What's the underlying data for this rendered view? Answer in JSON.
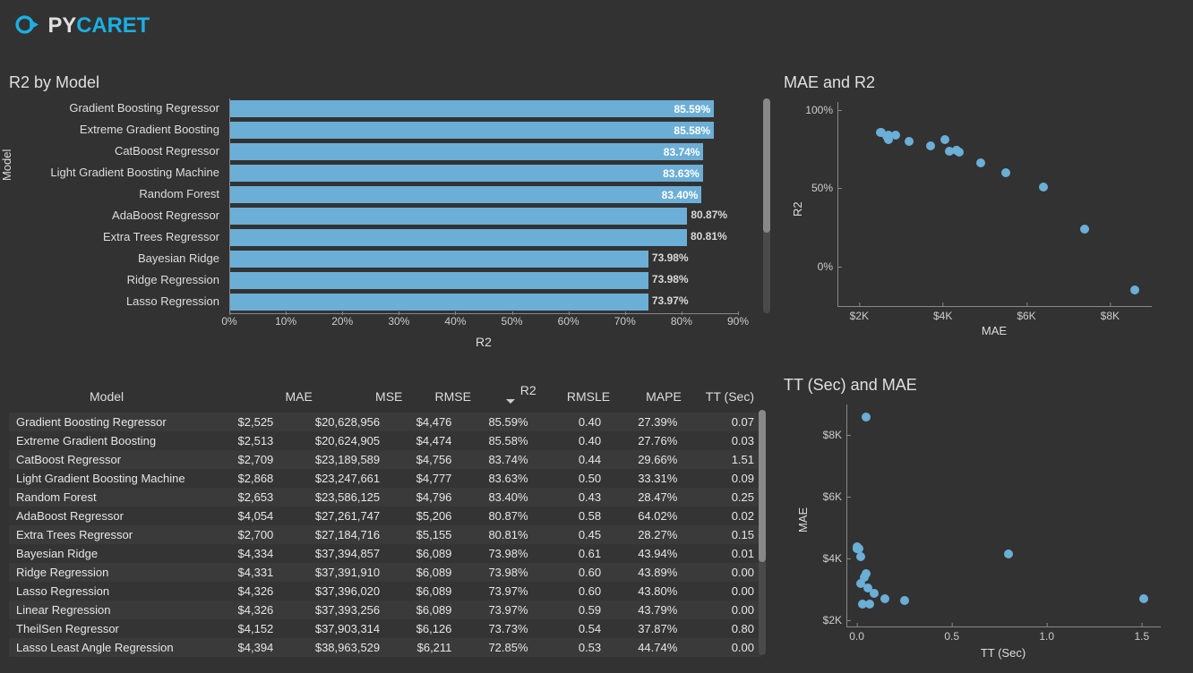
{
  "brand": "PYCARET",
  "colors": {
    "bar": "#6baed6",
    "dot": "#6baed6"
  },
  "bar_chart": {
    "title": "R2 by Model",
    "y_title": "Model",
    "x_title": "R2",
    "x_ticks": [
      "0%",
      "10%",
      "20%",
      "30%",
      "40%",
      "50%",
      "60%",
      "70%",
      "80%",
      "90%"
    ],
    "xmax": 90
  },
  "chart_data": {
    "type": "bar",
    "title": "R2 by Model",
    "xlabel": "R2",
    "ylabel": "Model",
    "xlim": [
      0,
      90
    ],
    "categories": [
      "Gradient Boosting Regressor",
      "Extreme Gradient Boosting",
      "CatBoost Regressor",
      "Light Gradient Boosting Machine",
      "Random Forest",
      "AdaBoost Regressor",
      "Extra Trees Regressor",
      "Bayesian Ridge",
      "Ridge Regression",
      "Lasso Regression"
    ],
    "values": [
      85.59,
      85.58,
      83.74,
      83.63,
      83.4,
      80.87,
      80.81,
      73.98,
      73.98,
      73.97
    ],
    "value_labels": [
      "85.59%",
      "85.58%",
      "83.74%",
      "83.63%",
      "83.40%",
      "80.87%",
      "80.81%",
      "73.98%",
      "73.98%",
      "73.97%"
    ]
  },
  "scatter1": {
    "title": "MAE and R2",
    "xlabel": "MAE",
    "ylabel": "R2",
    "x_ticks": [
      {
        "v": 2000,
        "l": "$2K"
      },
      {
        "v": 4000,
        "l": "$4K"
      },
      {
        "v": 6000,
        "l": "$6K"
      },
      {
        "v": 8000,
        "l": "$8K"
      }
    ],
    "y_ticks": [
      {
        "v": 0,
        "l": "0%"
      },
      {
        "v": 50,
        "l": "50%"
      },
      {
        "v": 100,
        "l": "100%"
      }
    ],
    "xlim": [
      1500,
      9000
    ],
    "ylim": [
      -25,
      105
    ]
  },
  "scatter2": {
    "title": "TT (Sec) and MAE",
    "xlabel": "TT (Sec)",
    "ylabel": "MAE",
    "x_ticks": [
      {
        "v": 0.0,
        "l": "0.0"
      },
      {
        "v": 0.5,
        "l": "0.5"
      },
      {
        "v": 1.0,
        "l": "1.0"
      },
      {
        "v": 1.5,
        "l": "1.5"
      }
    ],
    "y_ticks": [
      {
        "v": 2000,
        "l": "$2K"
      },
      {
        "v": 4000,
        "l": "$4K"
      },
      {
        "v": 6000,
        "l": "$6K"
      },
      {
        "v": 8000,
        "l": "$8K"
      }
    ],
    "xlim": [
      -0.05,
      1.6
    ],
    "ylim": [
      1800,
      9000
    ]
  },
  "table": {
    "headers": [
      "Model",
      "MAE",
      "MSE",
      "RMSE",
      "R2",
      "RMSLE",
      "MAPE",
      "TT (Sec)"
    ],
    "sort_col": 4,
    "rows": [
      {
        "model": "Gradient Boosting Regressor",
        "mae": 2525,
        "mse": 20628956,
        "rmse": 4476,
        "r2": 85.59,
        "rmsle": 0.4,
        "mape": 27.39,
        "tt": 0.07
      },
      {
        "model": "Extreme Gradient Boosting",
        "mae": 2513,
        "mse": 20624905,
        "rmse": 4474,
        "r2": 85.58,
        "rmsle": 0.4,
        "mape": 27.76,
        "tt": 0.03
      },
      {
        "model": "CatBoost Regressor",
        "mae": 2709,
        "mse": 23189589,
        "rmse": 4756,
        "r2": 83.74,
        "rmsle": 0.44,
        "mape": 29.66,
        "tt": 1.51
      },
      {
        "model": "Light Gradient Boosting Machine",
        "mae": 2868,
        "mse": 23247661,
        "rmse": 4777,
        "r2": 83.63,
        "rmsle": 0.5,
        "mape": 33.31,
        "tt": 0.09
      },
      {
        "model": "Random Forest",
        "mae": 2653,
        "mse": 23586125,
        "rmse": 4796,
        "r2": 83.4,
        "rmsle": 0.43,
        "mape": 28.47,
        "tt": 0.25
      },
      {
        "model": "AdaBoost Regressor",
        "mae": 4054,
        "mse": 27261747,
        "rmse": 5206,
        "r2": 80.87,
        "rmsle": 0.58,
        "mape": 64.02,
        "tt": 0.02
      },
      {
        "model": "Extra Trees Regressor",
        "mae": 2700,
        "mse": 27184716,
        "rmse": 5155,
        "r2": 80.81,
        "rmsle": 0.45,
        "mape": 28.27,
        "tt": 0.15
      },
      {
        "model": "Bayesian Ridge",
        "mae": 4334,
        "mse": 37394857,
        "rmse": 6089,
        "r2": 73.98,
        "rmsle": 0.61,
        "mape": 43.94,
        "tt": 0.01
      },
      {
        "model": "Ridge Regression",
        "mae": 4331,
        "mse": 37391910,
        "rmse": 6089,
        "r2": 73.98,
        "rmsle": 0.6,
        "mape": 43.89,
        "tt": 0.0
      },
      {
        "model": "Lasso Regression",
        "mae": 4326,
        "mse": 37396020,
        "rmse": 6089,
        "r2": 73.97,
        "rmsle": 0.6,
        "mape": 43.8,
        "tt": 0.0
      },
      {
        "model": "Linear Regression",
        "mae": 4326,
        "mse": 37393256,
        "rmse": 6089,
        "r2": 73.97,
        "rmsle": 0.59,
        "mape": 43.79,
        "tt": 0.0
      },
      {
        "model": "TheilSen Regressor",
        "mae": 4152,
        "mse": 37903314,
        "rmse": 6126,
        "r2": 73.73,
        "rmsle": 0.54,
        "mape": 37.87,
        "tt": 0.8
      },
      {
        "model": "Lasso Least Angle Regression",
        "mae": 4394,
        "mse": 38963529,
        "rmse": 6211,
        "r2": 72.85,
        "rmsle": 0.53,
        "mape": 44.74,
        "tt": 0.0
      }
    ],
    "scatter1_extra": [
      {
        "mae": 3200,
        "r2": 80
      },
      {
        "mae": 3700,
        "r2": 77
      },
      {
        "mae": 4900,
        "r2": 66
      },
      {
        "mae": 5500,
        "r2": 60
      },
      {
        "mae": 6400,
        "r2": 51
      },
      {
        "mae": 7400,
        "r2": 24
      },
      {
        "mae": 8600,
        "r2": -15
      }
    ],
    "scatter2_extra": [
      {
        "tt": 0.05,
        "mae": 8600
      },
      {
        "tt": 0.02,
        "mae": 3200
      },
      {
        "tt": 0.04,
        "mae": 3400
      },
      {
        "tt": 0.06,
        "mae": 3050
      },
      {
        "tt": 0.05,
        "mae": 3500
      }
    ]
  }
}
